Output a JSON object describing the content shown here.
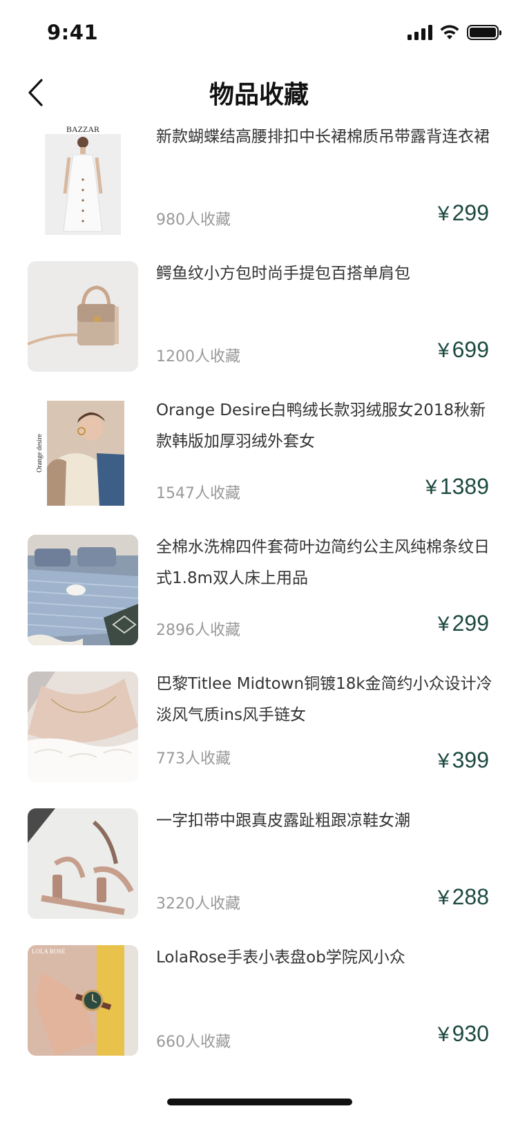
{
  "status_bar": {
    "time": "9:41"
  },
  "nav": {
    "title": "物品收藏"
  },
  "currency": "¥",
  "colors": {
    "price": "#1d4a40",
    "count": "#999999",
    "title": "#333333"
  },
  "items": [
    {
      "title": "新款蝴蝶结高腰排扣中长裙棉质吊带露背连衣裙",
      "count": "980人收藏",
      "price": "299",
      "image": "white-dress-photo",
      "image_caption": "BAZZAR"
    },
    {
      "title": "鳄鱼纹小方包时尚手提包百搭单肩包",
      "count": "1200人收藏",
      "price": "699",
      "image": "handbag-photo"
    },
    {
      "title": "Orange Desire白鸭绒长款羽绒服女2018秋新款韩版加厚羽绒外套女",
      "count": "1547人收藏",
      "price": "1389",
      "image": "down-jacket-photo",
      "image_caption": "Orange desire"
    },
    {
      "title": "全棉水洗棉四件套荷叶边简约公主风纯棉条纹日式1.8m双人床上用品",
      "count": "2896人收藏",
      "price": "299",
      "image": "bedding-photo"
    },
    {
      "title": "巴黎Titlee Midtown铜镀18k金简约小众设计冷淡风气质ins风手链女",
      "count": "773人收藏",
      "price": "399",
      "image": "necklace-photo"
    },
    {
      "title": "一字扣带中跟真皮露趾粗跟凉鞋女潮",
      "count": "3220人收藏",
      "price": "288",
      "image": "sandals-photo"
    },
    {
      "title": "LolaRose手表小表盘ob学院风小众",
      "count": "660人收藏",
      "price": "930",
      "image": "watch-photo",
      "image_caption": "LOLA ROSE"
    }
  ]
}
